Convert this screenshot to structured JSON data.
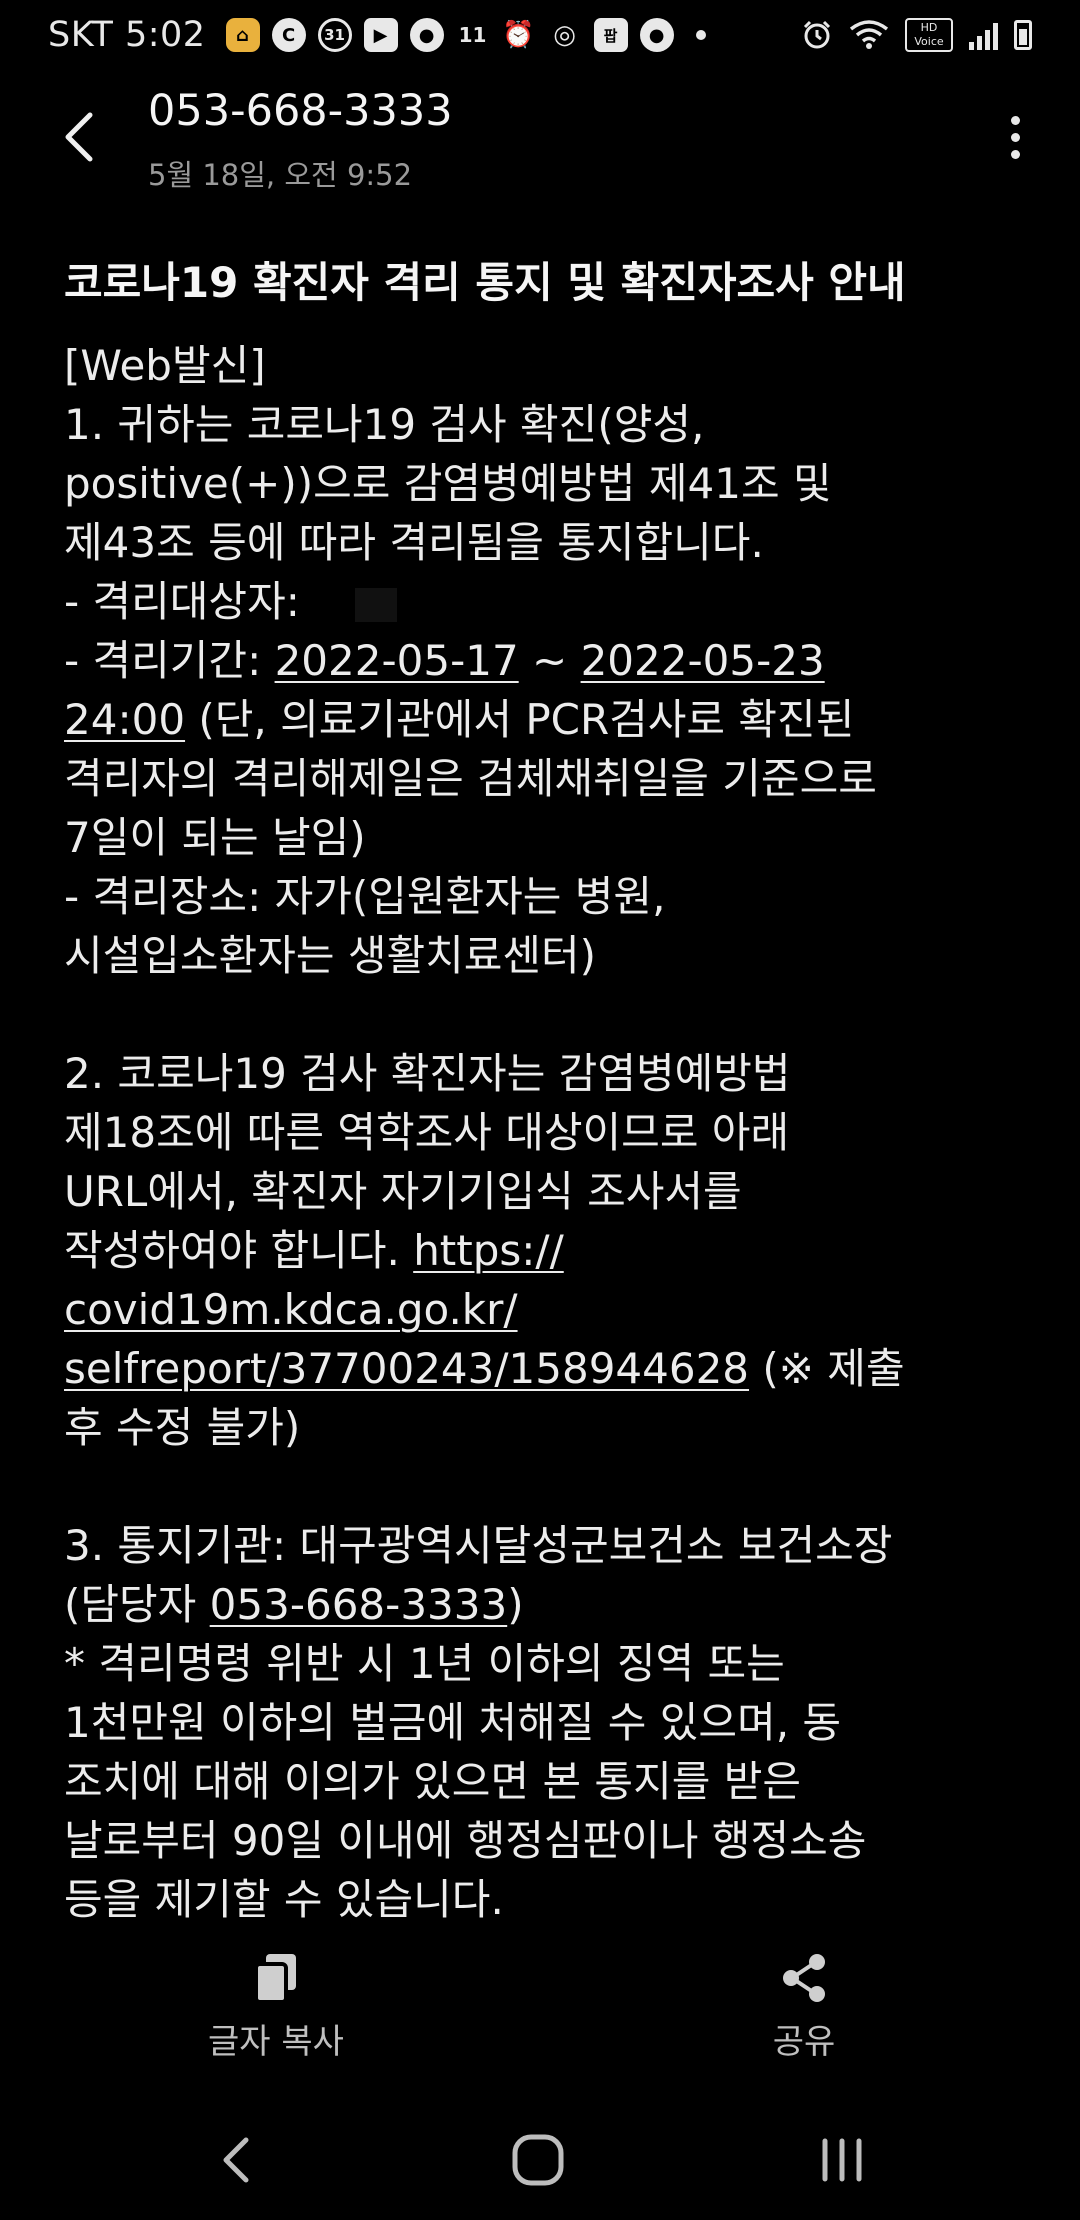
{
  "status_bar": {
    "carrier_time": "SKT 5:02",
    "notification_icons": [
      {
        "name": "home-app-icon",
        "glyph": "⌂"
      },
      {
        "name": "c-app-icon",
        "glyph": "C"
      },
      {
        "name": "calendar-31-icon",
        "glyph": "31"
      },
      {
        "name": "youtube-icon",
        "glyph": "▶"
      },
      {
        "name": "chat-bubble-icon",
        "glyph": "●"
      },
      {
        "name": "eleventh-street-icon",
        "glyph": "11"
      },
      {
        "name": "alarm-icon",
        "glyph": "⏰"
      },
      {
        "name": "instagram-icon",
        "glyph": "◎"
      },
      {
        "name": "app-badge-icon",
        "glyph": "팝"
      },
      {
        "name": "message-bubble-icon",
        "glyph": "●"
      }
    ],
    "hd_voice": "HD Voice"
  },
  "header": {
    "title": "053-668-3333",
    "subtitle": "5월 18일, 오전 9:52"
  },
  "message": {
    "title": "코로나19 확진자 격리 통지 및 확진자조사 안내",
    "lines": {
      "web": "[Web발신]",
      "s1_l1": "1. 귀하는 코로나19 검사 확진(양성,",
      "s1_l2": "positive(+))으로 감염병예방법 제41조 및",
      "s1_l3": "제43조 등에 따라 격리됨을 통지합니다.",
      "target": " - 격리대상자: ",
      "period_prefix": " - 격리기간: ",
      "period_start": "2022-05-17",
      "period_sep": " ~ ",
      "period_end_date": "2022-05-23",
      "period_end_time": "24:00",
      "period_note1": " (단, 의료기관에서 PCR검사로 확진된",
      "period_note2": "격리자의 격리해제일은 검체채취일을 기준으로",
      "period_note3": "7일이 되는 날임)",
      "place1": " - 격리장소: 자가(입원환자는 병원,",
      "place2": "시설입소환자는 생활치료센터)",
      "s2_l1": "2. 코로나19 검사 확진자는 감염병예방법",
      "s2_l2": "제18조에 따른 역학조사 대상이므로 아래",
      "s2_l3": "URL에서, 확진자 자기기입식 조사서를",
      "s2_l4": "작성하여야 합니다. ",
      "url_part1": "https://",
      "url_part2": "covid19m.kdca.go.kr/",
      "url_part3": "selfreport/37700243/158944628",
      "url_note": " (※ 제출",
      "url_note2": "후 수정 불가)",
      "s3_l1": "3. 통지기관: 대구광역시달성군보건소 보건소장",
      "s3_l2_prefix": "(담당자 ",
      "s3_phone": "053-668-3333",
      "s3_l2_suffix": ")",
      "warn1": "  * 격리명령 위반 시 1년 이하의 징역 또는",
      "warn2": "1천만원 이하의 벌금에 처해질 수 있으며, 동",
      "warn3": "조치에 대해 이의가 있으면 본 통지를 받은",
      "warn4": "날로부터 90일 이내에 행정심판이나 행정소송",
      "warn5": "등을 제기할 수 있습니다."
    }
  },
  "actions": {
    "copy_label": "글자 복사",
    "share_label": "공유"
  },
  "colors": {
    "background": "#000000",
    "text": "#ececec",
    "subtext": "#9a9a9a"
  }
}
